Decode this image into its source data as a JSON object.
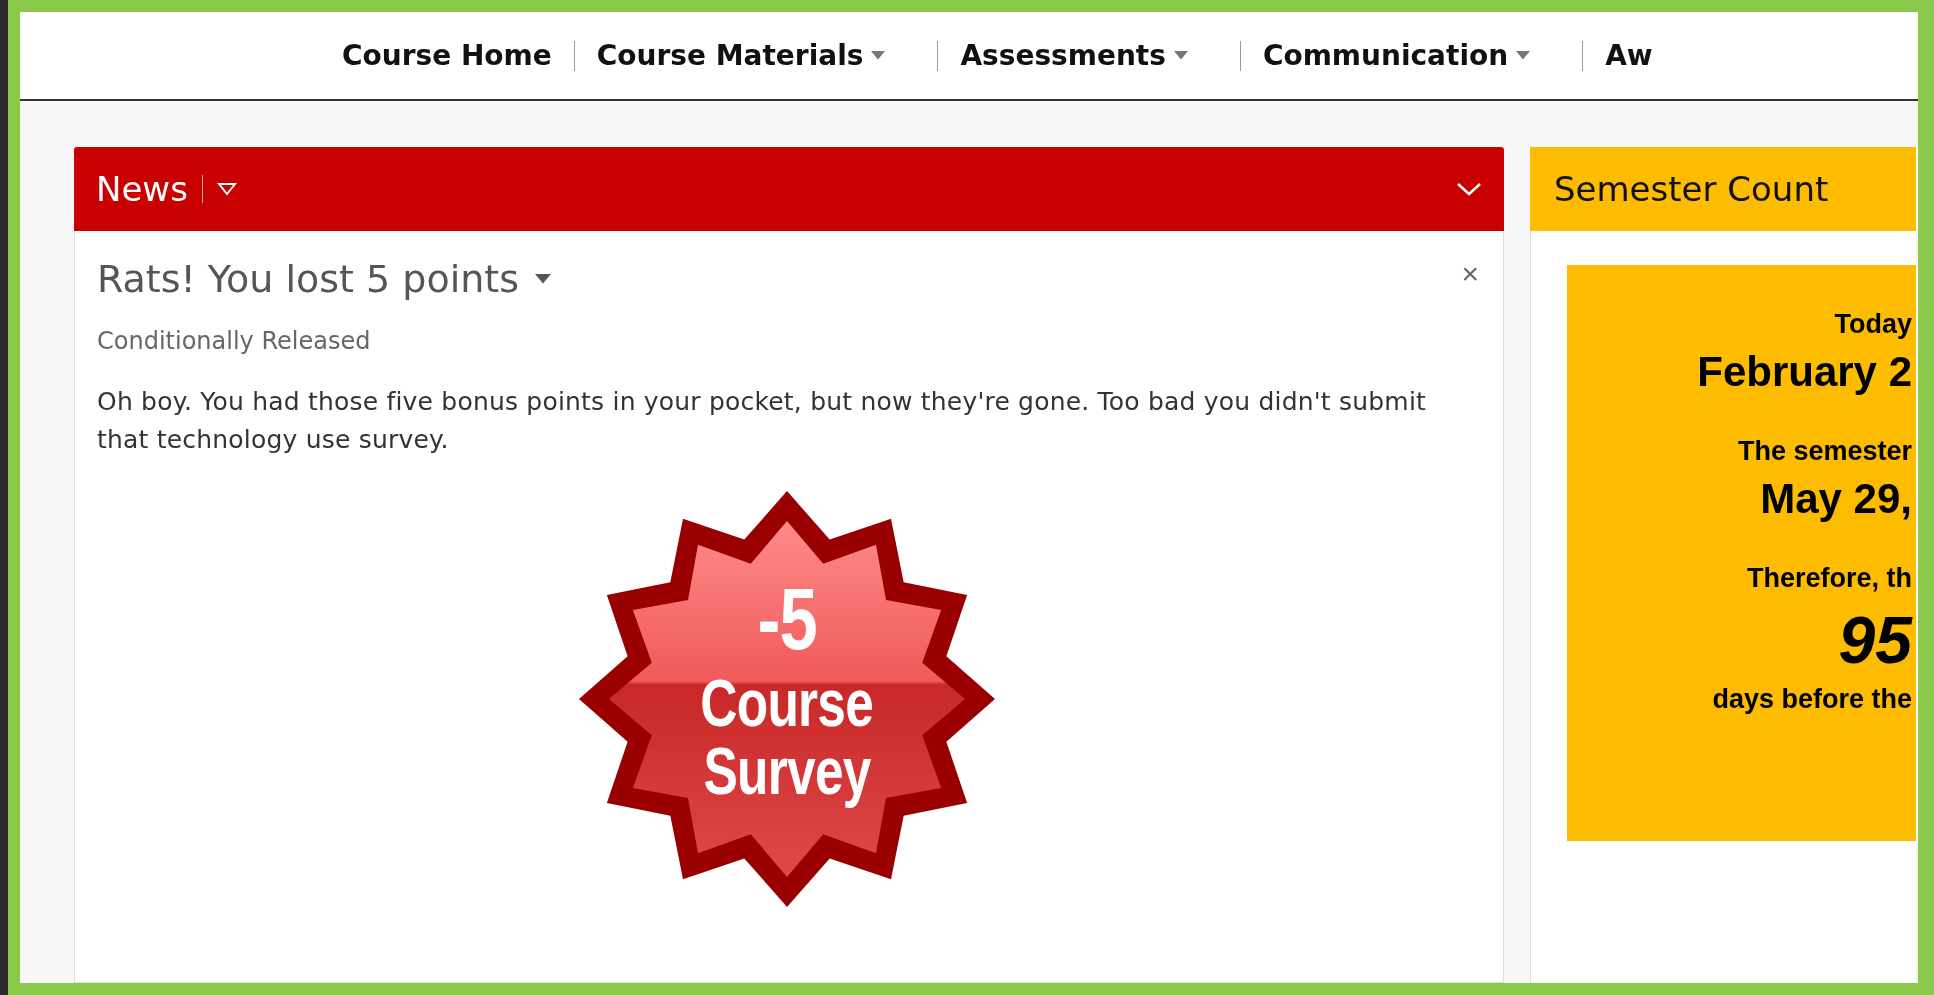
{
  "nav": {
    "items": [
      {
        "label": "Course Home",
        "dropdown": false
      },
      {
        "label": "Course Materials",
        "dropdown": true
      },
      {
        "label": "Assessments",
        "dropdown": true
      },
      {
        "label": "Communication",
        "dropdown": true
      },
      {
        "label": "Aw",
        "dropdown": false
      }
    ]
  },
  "news": {
    "title": "News",
    "item": {
      "close": "×",
      "title": "Rats! You lost 5 points",
      "status": "Conditionally Released",
      "body": "Oh boy. You had those five bonus points in your pocket, but now they're gone. Too bad you didn't submit that technology use survey.",
      "badge": {
        "value": "-5",
        "lines": [
          "Course",
          "Survey"
        ]
      }
    }
  },
  "countdown": {
    "title": "Semester Count",
    "lines": [
      {
        "text": "Today",
        "kind": "label"
      },
      {
        "text": "February 2",
        "kind": "date"
      },
      {
        "text": "The semester",
        "kind": "label"
      },
      {
        "text": "May 29,",
        "kind": "date"
      },
      {
        "text": "Therefore, th",
        "kind": "label"
      },
      {
        "text": "95",
        "kind": "number"
      },
      {
        "text": "days before the",
        "kind": "label"
      }
    ]
  }
}
